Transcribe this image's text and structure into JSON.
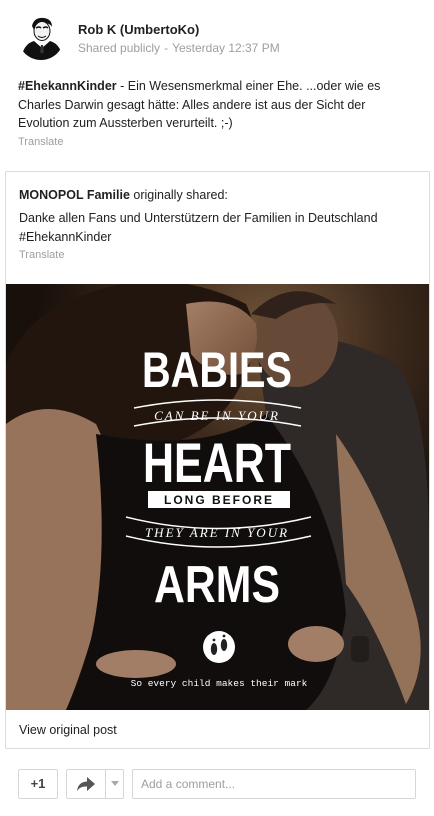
{
  "post": {
    "author": "Rob K (UmbertoKo)",
    "visibility": "Shared publicly",
    "separator": "-",
    "timestamp": "Yesterday 12:37 PM",
    "hashtag": "#EhekannKinder",
    "text": " - Ein Wesensmerkmal einer Ehe. ...oder wie es Charles Darwin gesagt hätte: Alles andere ist aus der Sicht der Evolution zum Aussterben verurteilt. ;-)",
    "translate_label": "Translate"
  },
  "shared": {
    "original_author": "MONOPOL Familie",
    "originally_shared": " originally shared:",
    "text": "Danke allen Fans und Unterstützern der Familien in Deutschland #EhekannKinder",
    "translate_label": "Translate",
    "view_original_label": "View original post",
    "poster": {
      "line1": "BABIES",
      "line2": "CAN BE IN YOUR",
      "line3": "HEART",
      "line4": "LONG BEFORE",
      "line5": "THEY ARE IN YOUR",
      "line6": "ARMS",
      "tagline": "So every child makes their mark"
    }
  },
  "actions": {
    "plus_one_label": "+1",
    "comment_placeholder": "Add a comment..."
  },
  "colors": {
    "meta_text": "#9e9e9e",
    "border": "#dcdcdc",
    "poster_text": "#ffffff"
  },
  "icons": [
    "avatar-portrait-icon",
    "share-arrow-icon",
    "chevron-down-icon",
    "footprints-logo-icon"
  ]
}
